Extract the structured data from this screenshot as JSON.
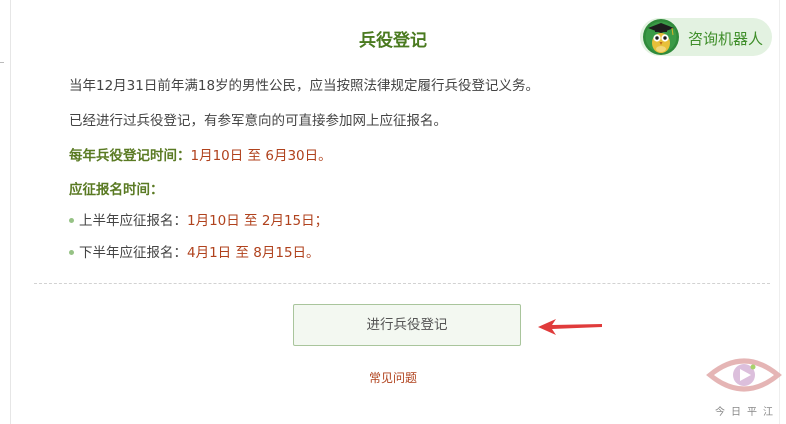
{
  "page": {
    "title": "兵役登记"
  },
  "robot": {
    "label": "咨询机器人",
    "avatar_icon": "owl-graduate-icon",
    "bg_color": "#e3f2e1"
  },
  "content": {
    "line1": "当年12月31日前年满18岁的男性公民，应当按照法律规定履行兵役登记义务。",
    "line2": "已经进行过兵役登记，有参军意向的可直接参加网上应征报名。",
    "registration_time": {
      "label": "每年兵役登记时间：",
      "value": "1月10日 至 6月30日。"
    },
    "enlistment_heading": "应征报名时间：",
    "first_half": {
      "label": "上半年应征报名：",
      "value": "1月10日 至 2月15日；"
    },
    "second_half": {
      "label": "下半年应征报名：",
      "value": "4月1日 至 8月15日。"
    }
  },
  "actions": {
    "register_button": "进行兵役登记",
    "faq_link": "常见问题"
  },
  "watermark": {
    "text": "今日平江",
    "icon": "play-eye-logo-icon"
  },
  "colors": {
    "title_green": "#4a7a1f",
    "accent_red": "#b0421d",
    "arrow_red": "#e03b3b"
  }
}
